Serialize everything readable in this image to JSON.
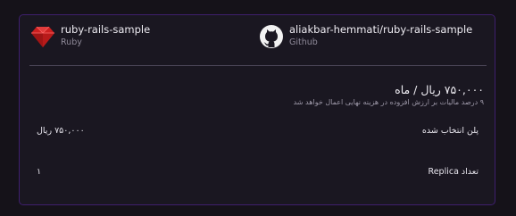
{
  "sources": {
    "repo": {
      "title": "ruby-rails-sample",
      "subtitle": "Ruby",
      "icon": "ruby-icon"
    },
    "github": {
      "title": "aliakbar-hemmati/ruby-rails-sample",
      "subtitle": "Github",
      "icon": "github-icon"
    }
  },
  "plan": {
    "price": "۷۵۰,۰۰۰ ریال / ماه",
    "tax_note": "۹ درصد مالیات بر ارزش افزوده در هزینه نهایی اعمال خواهد شد"
  },
  "rows": [
    {
      "label": "پلن انتخاب شده",
      "value": "۷۵۰,۰۰۰ ریال"
    },
    {
      "label": "تعداد Replica",
      "value": "۱"
    }
  ],
  "colors": {
    "accent_border": "#3f1f6e",
    "ruby_red": "#cc1f1f",
    "background": "#151219"
  }
}
